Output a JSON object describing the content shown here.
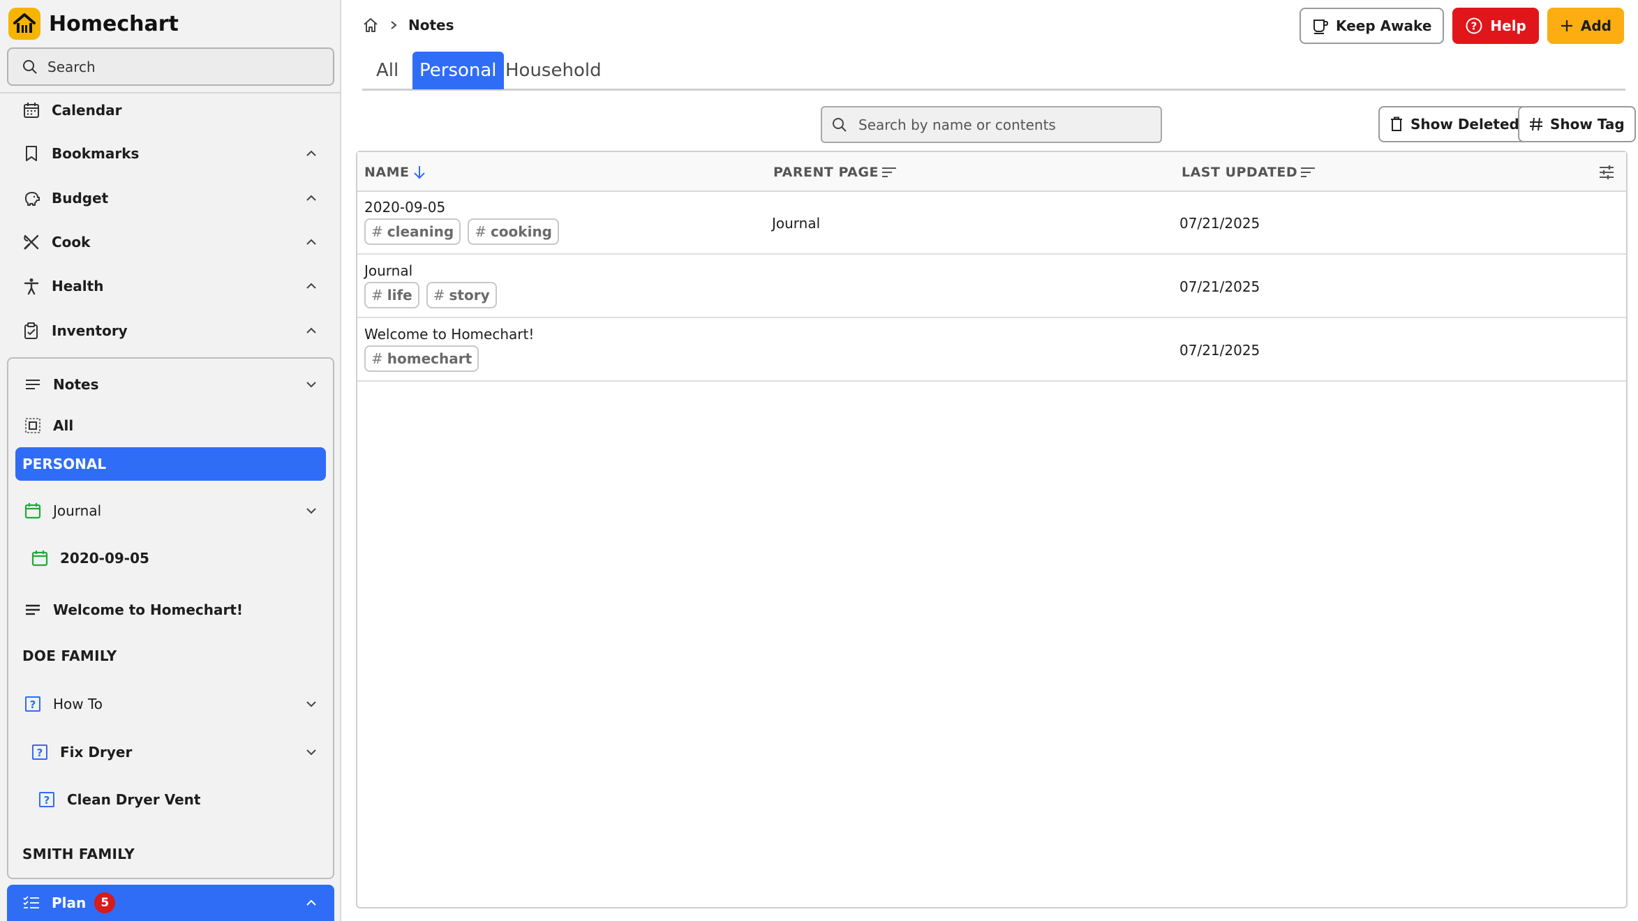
{
  "app": {
    "name": "Homechart"
  },
  "sidebar": {
    "search_label": "Search",
    "items": [
      {
        "label": "Calendar",
        "icon": "calendar-icon"
      },
      {
        "label": "Bookmarks",
        "icon": "bookmark-icon"
      },
      {
        "label": "Budget",
        "icon": "piggy-bank-icon"
      },
      {
        "label": "Cook",
        "icon": "utensils-icon"
      },
      {
        "label": "Health",
        "icon": "person-icon"
      },
      {
        "label": "Inventory",
        "icon": "clipboard-icon"
      }
    ],
    "notes": {
      "label": "Notes",
      "all_label": "All",
      "personal_header": "PERSONAL",
      "journal": "Journal",
      "journal_child": "2020-09-05",
      "welcome": "Welcome to Homechart!",
      "doe_header": "DOE FAMILY",
      "how_to": "How To",
      "fix_dryer": "Fix Dryer",
      "clean_vent": "Clean Dryer Vent",
      "smith_header": "SMITH FAMILY"
    },
    "plan": {
      "label": "Plan",
      "badge": "5"
    }
  },
  "header": {
    "breadcrumb": "Notes",
    "keep_awake": "Keep Awake",
    "help": "Help",
    "add": "Add"
  },
  "tabs": [
    "All",
    "Personal",
    "Household"
  ],
  "active_tab": "Personal",
  "toolbar": {
    "search_placeholder": "Search by name or contents",
    "show_deleted": "Show Deleted",
    "show_tag": "Show Tag"
  },
  "table": {
    "columns": [
      "NAME",
      "PARENT PAGE",
      "LAST UPDATED"
    ],
    "rows": [
      {
        "name": "2020-09-05",
        "tags": [
          "cleaning",
          "cooking"
        ],
        "parent": "Journal",
        "updated": "07/21/2025"
      },
      {
        "name": "Journal",
        "tags": [
          "life",
          "story"
        ],
        "parent": "",
        "updated": "07/21/2025"
      },
      {
        "name": "Welcome to Homechart!",
        "tags": [
          "homechart"
        ],
        "parent": "",
        "updated": "07/21/2025"
      }
    ]
  },
  "colors": {
    "accent": "#2f6df6",
    "danger": "#e0161b",
    "warning": "#fbad11",
    "brand": "#f5b400"
  }
}
